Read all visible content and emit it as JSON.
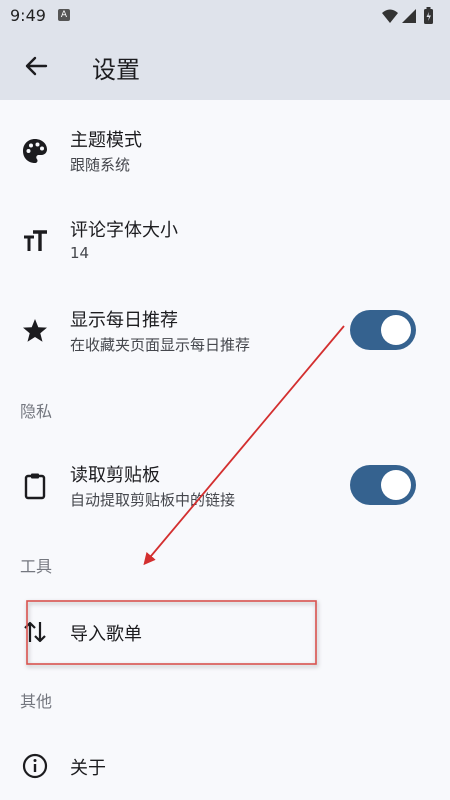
{
  "status_bar": {
    "time": "9:49",
    "notification_letter": "A"
  },
  "app_bar": {
    "title": "设置"
  },
  "settings": {
    "theme": {
      "title": "主题模式",
      "subtitle": "跟随系统"
    },
    "font_size": {
      "title": "评论字体大小",
      "subtitle": "14"
    },
    "daily_recommend": {
      "title": "显示每日推荐",
      "subtitle": "在收藏夹页面显示每日推荐",
      "enabled": true
    },
    "privacy_header": "隐私",
    "clipboard": {
      "title": "读取剪贴板",
      "subtitle": "自动提取剪贴板中的链接",
      "enabled": true
    },
    "tools_header": "工具",
    "import_playlist": {
      "title": "导入歌单"
    },
    "other_header": "其他",
    "about": {
      "title": "关于"
    }
  },
  "colors": {
    "app_bar_bg": "#dfe3eb",
    "background": "#f8f9fc",
    "toggle_on": "#35628f",
    "annotation": "#d32f2f"
  },
  "icons": [
    "arrow-back-icon",
    "palette-icon",
    "text-size-icon",
    "star-icon",
    "clipboard-icon",
    "swap-vertical-icon",
    "info-icon",
    "wifi-icon",
    "signal-icon",
    "battery-icon"
  ]
}
